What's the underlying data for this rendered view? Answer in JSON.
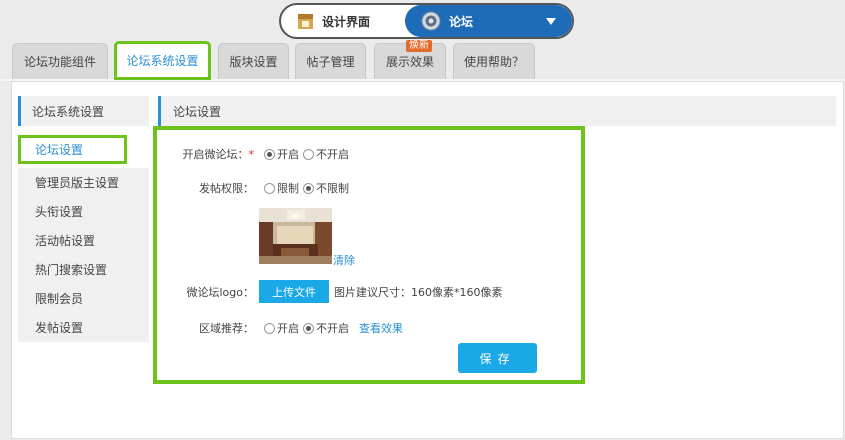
{
  "switcher": {
    "design_label": "设计界面",
    "forum_label": "论坛"
  },
  "tabs": [
    {
      "label": "论坛功能组件"
    },
    {
      "label": "论坛系统设置"
    },
    {
      "label": "版块设置"
    },
    {
      "label": "帖子管理"
    },
    {
      "label": "展示效果",
      "badge": "焕新"
    },
    {
      "label": "使用帮助？"
    }
  ],
  "sidebar": {
    "title": "论坛系统设置",
    "items": [
      {
        "label": "论坛设置"
      },
      {
        "label": "管理员版主设置"
      },
      {
        "label": "头衔设置"
      },
      {
        "label": "活动帖设置"
      },
      {
        "label": "热门搜索设置"
      },
      {
        "label": "限制会员"
      },
      {
        "label": "发帖设置"
      }
    ]
  },
  "main": {
    "title": "论坛设置",
    "form": {
      "enable": {
        "label": "开启微论坛：",
        "required_mark": "*",
        "opt_on": "开启",
        "opt_off": "不开启",
        "selected": "开启"
      },
      "post_perm": {
        "label": "发帖权限：",
        "opt_on": "限制",
        "opt_off": "不限制",
        "selected": "不限制"
      },
      "clear_link": "清除",
      "logo": {
        "label": "微论坛logo：",
        "upload_label": "上传文件",
        "hint": "图片建议尺寸：160像素*160像素"
      },
      "region": {
        "label": "区域推荐：",
        "opt_on": "开启",
        "opt_off": "不开启",
        "selected": "不开启",
        "preview_link": "查看效果"
      },
      "save_label": "保存"
    }
  },
  "colors": {
    "accent": "#2a8fd4",
    "highlight": "#6dc21c",
    "button": "#1ba8e6",
    "forum_switch": "#1e6bb8"
  }
}
